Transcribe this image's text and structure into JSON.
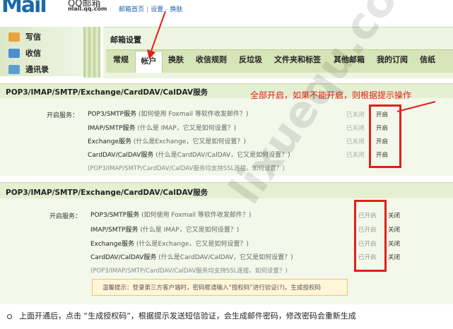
{
  "header": {
    "logo_text": "Mail",
    "logo_cn": "QQ邮箱",
    "logo_url": "mail.qq.com",
    "links": [
      "邮箱首页",
      "设置",
      "换肤"
    ]
  },
  "leftnav": {
    "items": [
      {
        "label": "写信",
        "icon": "pencil-icon"
      },
      {
        "label": "收信",
        "icon": "inbox-download-icon"
      },
      {
        "label": "通讯录",
        "icon": "contacts-icon"
      }
    ]
  },
  "settings": {
    "title": "邮箱设置",
    "tabs": [
      "常规",
      "帐户",
      "换肤",
      "收信规则",
      "反垃圾",
      "文件夹和标签",
      "其他邮箱",
      "我的订阅",
      "信纸"
    ],
    "active_tab": "帐户"
  },
  "annotation": "全部开启，如果不能开启，则根据提示操作",
  "panel1": {
    "title": "POP3/IMAP/SMTP/Exchange/CardDAV/CalDAV服务",
    "label": "开启服务：",
    "rows": [
      {
        "name": "POP3/SMTP服务",
        "hint": " (如何使用 Foxmail 等软件收发邮件？)",
        "status": "已关闭",
        "action": "开启"
      },
      {
        "name": "IMAP/SMTP服务",
        "hint": " (什么是 IMAP，它又是如何设置？)",
        "status": "已关闭",
        "action": "开启"
      },
      {
        "name": "Exchange服务",
        "hint": " (什么是Exchange，它又是如何设置？)",
        "status": "已关闭",
        "action": "开启"
      },
      {
        "name": "CardDAV/CalDAV服务",
        "hint": " (什么是CardDAV/CalDAV，它又是如何设置？)",
        "status": "已关闭",
        "action": "开启"
      }
    ],
    "note": "(POP3/IMAP/SMTP/CardDAV/CalDAV服务均支持SSL连接。如何设置？)"
  },
  "panel2": {
    "title": "POP3/IMAP/SMTP/Exchange/CardDAV/CalDAV服务",
    "label": "开启服务：",
    "rows": [
      {
        "name": "POP3/SMTP服务",
        "hint": " (如何使用 Foxmail 等软件收发邮件？)",
        "status": "已开启",
        "action": "关闭"
      },
      {
        "name": "IMAP/SMTP服务",
        "hint": " (什么是 IMAP，它又是如何设置？)",
        "status": "已开启",
        "action": "关闭"
      },
      {
        "name": "Exchange服务",
        "hint": " (什么是Exchange，它又是如何设置？)",
        "status": "已开启",
        "action": "关闭"
      },
      {
        "name": "CardDAV/CalDAV服务",
        "hint": " (什么是CardDAV/CalDAV，它又是如何设置？)",
        "status": "已开启",
        "action": "关闭"
      }
    ],
    "note": "(POP3/IMAP/SMTP/CardDAV/CalDAV服务均支持SSL连接。如何设置？)",
    "tip": "温馨提示：登录第三方客户端时，密码框请输入“授权码”进行验证(?)。生成授权码"
  },
  "bullet_text": "上面开通后，点击 “生成授权码”，根据提示发送短信验证，会生成邮件密码，修改密码会重新生成",
  "watermark": "lixuequ.com",
  "colors": {
    "accent_red": "#e0201a",
    "tab_bar": "#d6e5b7",
    "panel_bg": "#f3f8ea",
    "link_blue": "#1b5fa8"
  }
}
